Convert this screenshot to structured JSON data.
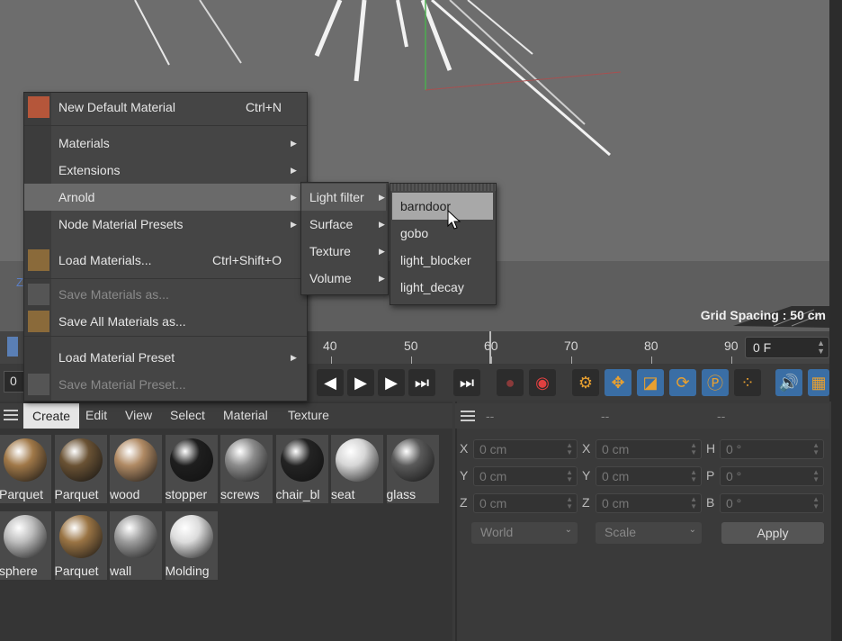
{
  "viewport": {
    "grid_spacing": "Grid Spacing : 50 cm",
    "axis_letter": "Z"
  },
  "timeline": {
    "ticks": [
      "40",
      "50",
      "60",
      "70",
      "80",
      "90"
    ],
    "left_marker": "0",
    "frame_value": "0 F",
    "frame_start": "0"
  },
  "material_manager": {
    "menu": [
      "Create",
      "Edit",
      "View",
      "Select",
      "Material",
      "Texture"
    ],
    "materials": [
      {
        "name": "Parquet",
        "color": "#a07848"
      },
      {
        "name": "Parquet",
        "color": "#6a5234"
      },
      {
        "name": "wood",
        "color": "#b08a64"
      },
      {
        "name": "stopper",
        "color": "#1e1e1e"
      },
      {
        "name": "screws",
        "color": "#8c8c8c"
      },
      {
        "name": "chair_bl",
        "color": "#232323"
      },
      {
        "name": "seat",
        "color": "#d6d6d6"
      },
      {
        "name": "glass",
        "color": "#5a5a5a"
      },
      {
        "name": "sphere",
        "color": "#bdbdbd"
      },
      {
        "name": "Parquet",
        "color": "#9a7444"
      },
      {
        "name": "wall",
        "color": "#9c9c9c"
      },
      {
        "name": "Molding",
        "color": "#dcdcdc"
      }
    ]
  },
  "coords": {
    "headers": [
      "--",
      "--",
      "--"
    ],
    "rows": [
      {
        "l1": "X",
        "v1": "0 cm",
        "l2": "X",
        "v2": "0 cm",
        "l3": "H",
        "v3": "0 °"
      },
      {
        "l1": "Y",
        "v1": "0 cm",
        "l2": "Y",
        "v2": "0 cm",
        "l3": "P",
        "v3": "0 °"
      },
      {
        "l1": "Z",
        "v1": "0 cm",
        "l2": "Z",
        "v2": "0 cm",
        "l3": "B",
        "v3": "0 °"
      }
    ],
    "mode_dropdown": "World",
    "scale_dropdown": "Scale",
    "apply": "Apply"
  },
  "context_menu": {
    "items": [
      {
        "label": "New Default Material",
        "shortcut": "Ctrl+N"
      },
      {
        "label": "Materials"
      },
      {
        "label": "Extensions"
      },
      {
        "label": "Arnold"
      },
      {
        "label": "Node Material Presets"
      },
      {
        "label": "Load Materials...",
        "shortcut": "Ctrl+Shift+O"
      },
      {
        "label": "Save Materials as..."
      },
      {
        "label": "Save All Materials as..."
      },
      {
        "label": "Load Material Preset"
      },
      {
        "label": "Save Material Preset..."
      }
    ]
  },
  "arnold_submenu": {
    "items": [
      "Light filter",
      "Surface",
      "Texture",
      "Volume"
    ]
  },
  "lightfilter_submenu": {
    "items": [
      "barndoor",
      "gobo",
      "light_blocker",
      "light_decay"
    ]
  },
  "colors": {
    "accent_blue": "#3a6ea5",
    "orange": "#e8a030",
    "highlight": "#6a6a6a"
  }
}
